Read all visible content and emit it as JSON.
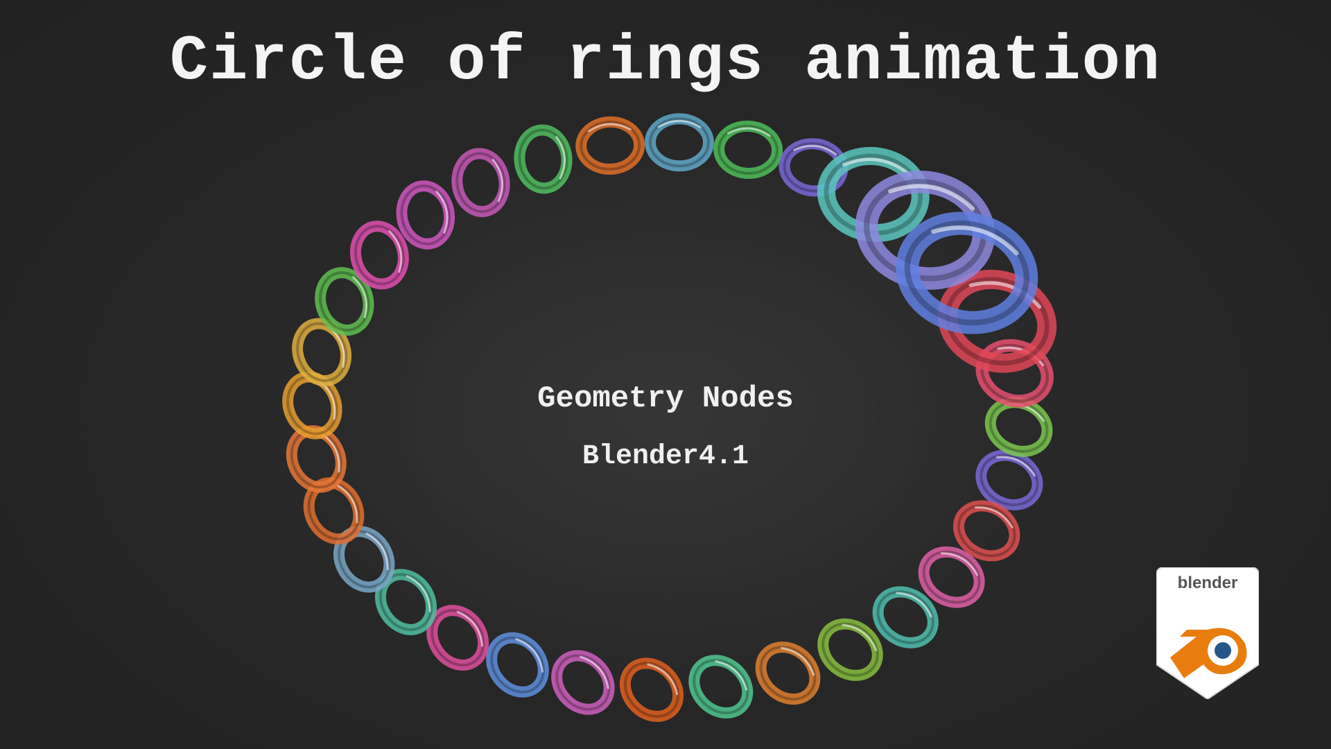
{
  "title": "Circle of rings animation",
  "subtitle_line1": "Geometry Nodes",
  "subtitle_line2": "Blender4.1",
  "logo": {
    "wordmark": "blender",
    "icon": "blender-logo-icon",
    "orange": "#e87d0d",
    "blue": "#265787"
  },
  "ring_colors": [
    "#e07028",
    "#5fa8c8",
    "#4fbf5a",
    "#7a6ad8",
    "#5cc8c0",
    "#8e8ae0",
    "#6080e0",
    "#e04858",
    "#e85070",
    "#7cc850",
    "#7a6ad8",
    "#e05050",
    "#e060a8",
    "#50c0b0",
    "#88c040",
    "#e08030",
    "#50c890",
    "#e06020",
    "#d060c0",
    "#6090e0",
    "#e050a0",
    "#50c0a0",
    "#7aa8c8",
    "#e07030",
    "#e87838",
    "#e8a030",
    "#e0b040",
    "#60c050",
    "#e050b0",
    "#d058c0",
    "#c85ab8",
    "#50c060"
  ]
}
